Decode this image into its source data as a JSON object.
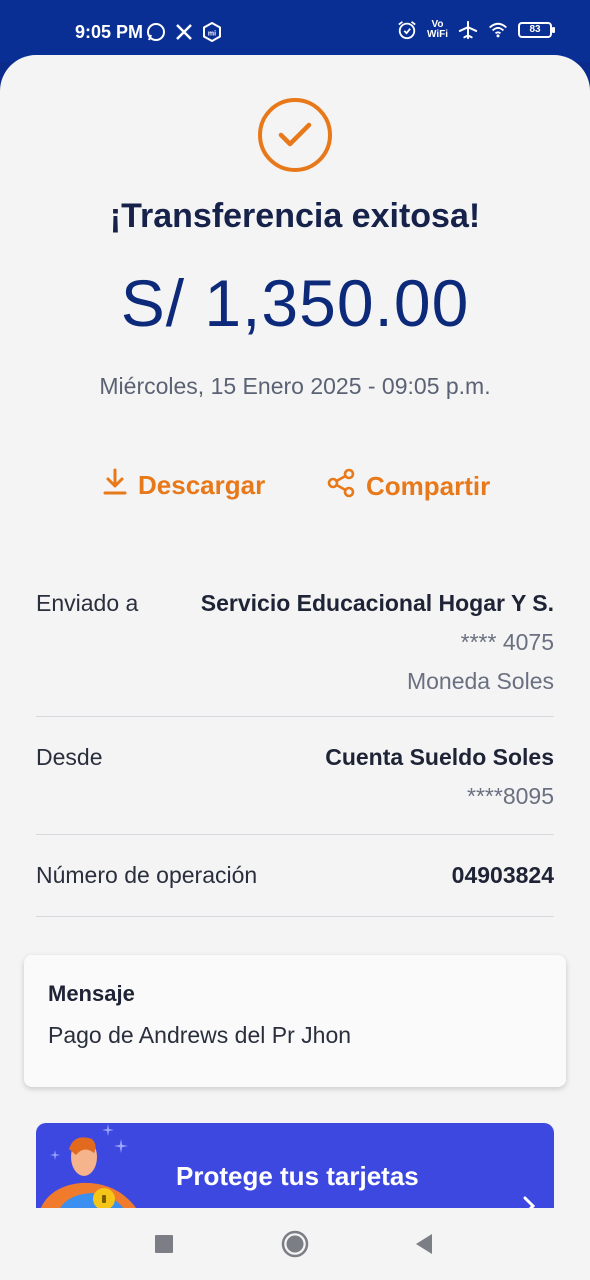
{
  "status_bar": {
    "time": "9:05 PM",
    "volte_top": "Vo",
    "volte_bottom": "WiFi",
    "battery": "83",
    "icons": [
      "whatsapp-icon",
      "x-icon",
      "mi-icon",
      "alarm-icon",
      "airplane-icon",
      "wifi-icon"
    ]
  },
  "receipt": {
    "title": "¡Transferencia exitosa!",
    "amount": "S/ 1,350.00",
    "datetime": "Miércoles, 15 Enero 2025 - 09:05 p.m."
  },
  "actions": {
    "download_label": "Descargar",
    "share_label": "Compartir"
  },
  "details": {
    "sent_to": {
      "label": "Enviado a",
      "name": "Servicio Educacional Hogar Y S.",
      "account": "**** 4075",
      "currency": "Moneda Soles"
    },
    "from": {
      "label": "Desde",
      "name": "Cuenta Sueldo Soles",
      "account": "****8095"
    },
    "operation": {
      "label": "Número de operación",
      "value": "04903824"
    }
  },
  "message": {
    "title": "Mensaje",
    "text": "Pago de Andrews del Pr Jhon"
  },
  "promo": {
    "text": "Protege tus tarjetas"
  },
  "colors": {
    "accent": "#e8791a",
    "primary": "#0d2a7a",
    "status_bar": "#0a2f94",
    "promo": "#3d48e0"
  }
}
